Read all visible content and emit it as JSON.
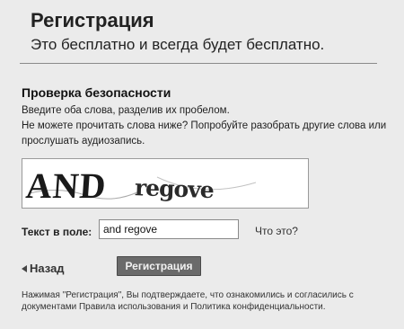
{
  "header": {
    "title": "Регистрация",
    "subtitle": "Это бесплатно и всегда будет бесплатно."
  },
  "security": {
    "title": "Проверка безопасности",
    "line1": "Введите оба слова, разделив их пробелом.",
    "line2": "Не можете прочитать слова ниже? Попробуйте разобрать другие слова или",
    "line3": "прослушать аудиозапись.",
    "captcha_word1": "AND",
    "captcha_word2": "regove"
  },
  "form": {
    "field_label": "Текст в поле:",
    "field_value": "and regove",
    "what_link": "Что это?",
    "back_label": "Назад",
    "submit_label": "Регистрация"
  },
  "legal": {
    "line1": "Нажимая \"Регистрация\", Вы подтверждаете, что ознакомились и согласились с",
    "line2": "документами Правила использования и Политика конфиденциальности."
  }
}
